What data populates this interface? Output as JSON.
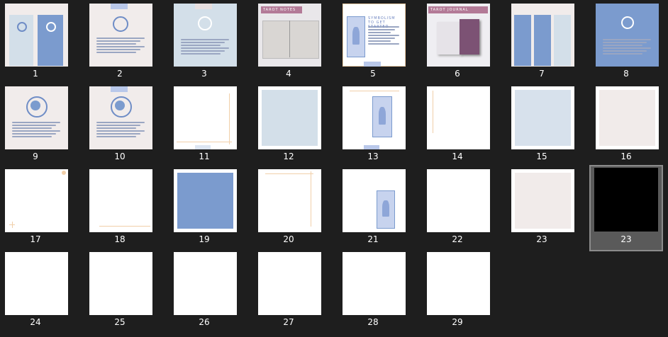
{
  "pages": [
    {
      "id": "page-1",
      "label": "1",
      "variant": "zodiac-cards-blue"
    },
    {
      "id": "page-2",
      "label": "2",
      "variant": "moon-pink"
    },
    {
      "id": "page-3",
      "label": "3",
      "variant": "symbol-blue"
    },
    {
      "id": "page-4",
      "label": "4",
      "variant": "tarot-notes",
      "title": "TAROT NOTES"
    },
    {
      "id": "page-5",
      "label": "5",
      "variant": "getting-started",
      "title": "SYMBOLISM TO GET STARTED"
    },
    {
      "id": "page-6",
      "label": "6",
      "variant": "tarot-journal",
      "title": "TAROT JOURNAL"
    },
    {
      "id": "page-7",
      "label": "7",
      "variant": "zodiac-three"
    },
    {
      "id": "page-8",
      "label": "8",
      "variant": "blue-full"
    },
    {
      "id": "page-9",
      "label": "9",
      "variant": "planet-pink"
    },
    {
      "id": "page-10",
      "label": "10",
      "variant": "planet-pink-2"
    },
    {
      "id": "page-11",
      "label": "11",
      "variant": "frame-corner"
    },
    {
      "id": "page-12",
      "label": "12",
      "variant": "light-blue"
    },
    {
      "id": "page-13",
      "label": "13",
      "variant": "card-right"
    },
    {
      "id": "page-14",
      "label": "14",
      "variant": "left-line"
    },
    {
      "id": "page-15",
      "label": "15",
      "variant": "light-blue-inset"
    },
    {
      "id": "page-16",
      "label": "16",
      "variant": "pink-inset"
    },
    {
      "id": "page-17",
      "label": "17",
      "variant": "corner-marks"
    },
    {
      "id": "page-18",
      "label": "18",
      "variant": "bottom-line"
    },
    {
      "id": "page-19",
      "label": "19",
      "variant": "blue-inset"
    },
    {
      "id": "page-20",
      "label": "20",
      "variant": "top-lines"
    },
    {
      "id": "page-21",
      "label": "21",
      "variant": "card-small"
    },
    {
      "id": "page-22",
      "label": "22",
      "variant": "blank"
    },
    {
      "id": "page-23",
      "label": "23",
      "variant": "pink-inset-2"
    },
    {
      "id": "page-23b",
      "label": "23",
      "variant": "black",
      "selected": true
    },
    {
      "id": "page-24",
      "label": "24",
      "variant": "blank"
    },
    {
      "id": "page-25",
      "label": "25",
      "variant": "blank"
    },
    {
      "id": "page-26",
      "label": "26",
      "variant": "blank"
    },
    {
      "id": "page-27",
      "label": "27",
      "variant": "blank"
    },
    {
      "id": "page-28",
      "label": "28",
      "variant": "blank"
    },
    {
      "id": "page-29",
      "label": "29",
      "variant": "blank"
    }
  ],
  "colors": {
    "background": "#1e1e1e",
    "blue": "#7b9bce",
    "light_blue": "#d3dfe9",
    "pink": "#f1eceb",
    "mauve": "#b37a97",
    "gold": "#f1cfa9",
    "selected": "#5a5a5a"
  }
}
